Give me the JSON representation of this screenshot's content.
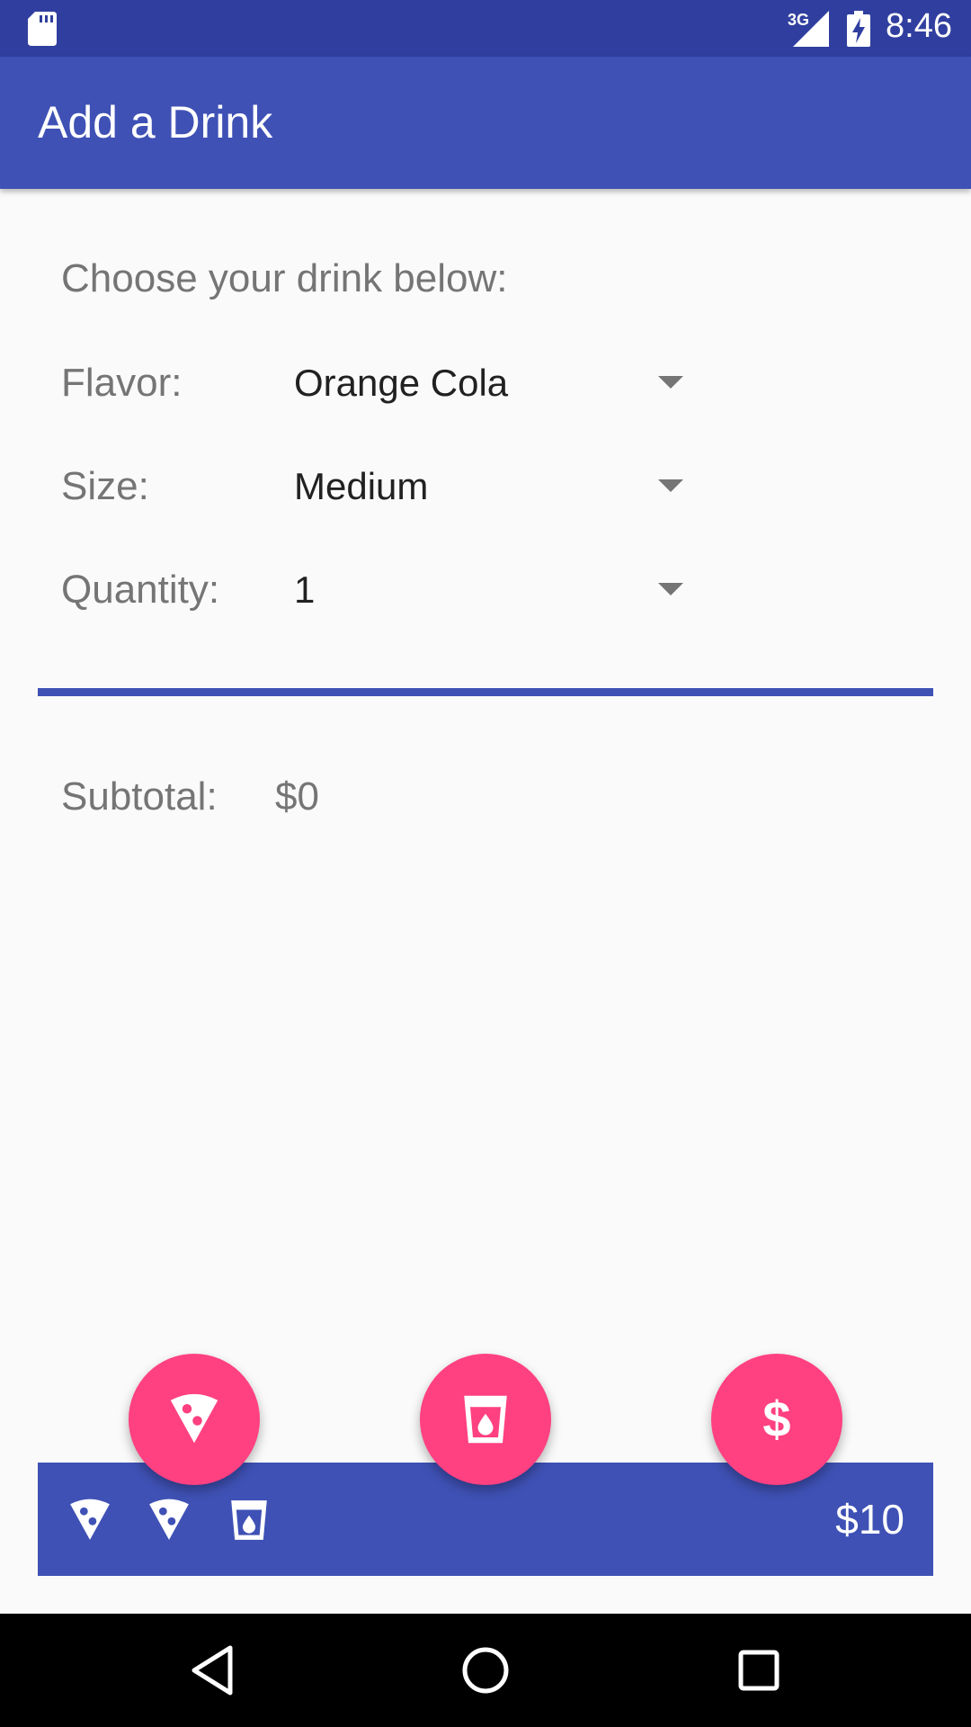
{
  "status_bar": {
    "network": "3G",
    "time": "8:46"
  },
  "app_bar": {
    "title": "Add a Drink"
  },
  "form": {
    "prompt": "Choose your drink below:",
    "flavor": {
      "label": "Flavor:",
      "value": "Orange Cola"
    },
    "size": {
      "label": "Size:",
      "value": "Medium"
    },
    "quantity": {
      "label": "Quantity:",
      "value": "1"
    }
  },
  "subtotal": {
    "label": "Subtotal:",
    "value": "$0"
  },
  "fabs": {
    "checkout_symbol": "$"
  },
  "cart_bar": {
    "items": [
      "pizza-icon",
      "pizza-icon",
      "drink-icon"
    ],
    "total": "$10"
  },
  "colors": {
    "primary": "#3F51B5",
    "primary_dark": "#303F9F",
    "accent": "#FF4081",
    "background": "#FAFAFA"
  }
}
